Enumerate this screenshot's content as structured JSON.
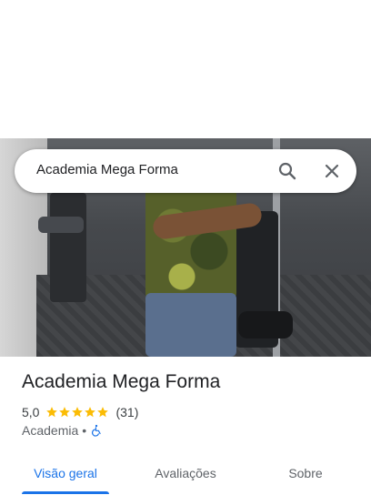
{
  "search": {
    "query": "Academia Mega Forma"
  },
  "place": {
    "name": "Academia Mega Forma",
    "rating": "5,0",
    "stars": 5,
    "review_count": "(31)",
    "category": "Academia",
    "separator": "•",
    "accessibility_icon": "wheelchair-icon"
  },
  "tabs": [
    {
      "label": "Visão geral",
      "active": true
    },
    {
      "label": "Avaliações",
      "active": false
    },
    {
      "label": "Sobre",
      "active": false
    }
  ],
  "colors": {
    "accent": "#1a73e8",
    "star": "#fbbc04",
    "text": "#202124",
    "muted": "#5f6368"
  },
  "icons": {
    "search": "search-icon",
    "close": "close-icon",
    "star": "star-icon"
  }
}
